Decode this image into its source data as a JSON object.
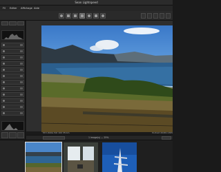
{
  "window": {
    "title": "Sean Lightspeed"
  },
  "menu": {
    "items": [
      "Fil",
      "Editer",
      "Affichage",
      "Aide"
    ]
  },
  "preview": {
    "info_left": "f/8 1/640s ISO 100 35mm",
    "info_right": "Portrait 2048×1365"
  },
  "status": {
    "text": "1 image(s) — 25%"
  },
  "colors": {
    "background": "#1a1a1a",
    "panel": "#242424",
    "selection": "#e0e0e0"
  }
}
